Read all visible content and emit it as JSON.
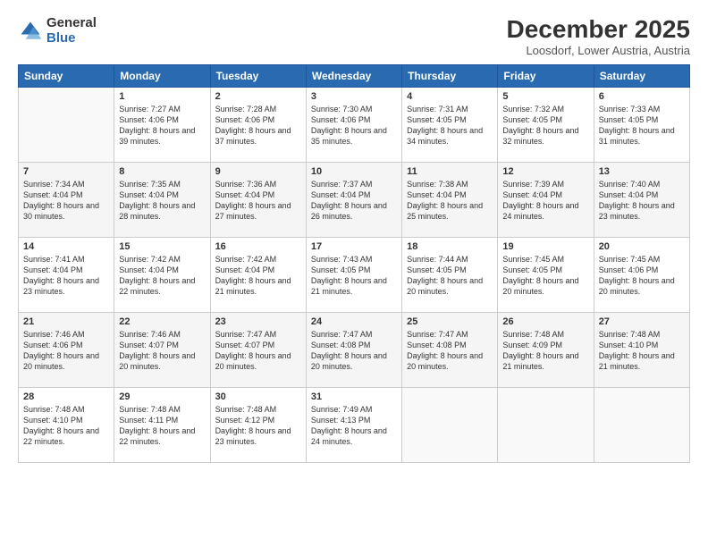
{
  "logo": {
    "general": "General",
    "blue": "Blue"
  },
  "title": "December 2025",
  "location": "Loosdorf, Lower Austria, Austria",
  "days_of_week": [
    "Sunday",
    "Monday",
    "Tuesday",
    "Wednesday",
    "Thursday",
    "Friday",
    "Saturday"
  ],
  "weeks": [
    [
      {
        "day": "",
        "sunrise": "",
        "sunset": "",
        "daylight": ""
      },
      {
        "day": "1",
        "sunrise": "Sunrise: 7:27 AM",
        "sunset": "Sunset: 4:06 PM",
        "daylight": "Daylight: 8 hours and 39 minutes."
      },
      {
        "day": "2",
        "sunrise": "Sunrise: 7:28 AM",
        "sunset": "Sunset: 4:06 PM",
        "daylight": "Daylight: 8 hours and 37 minutes."
      },
      {
        "day": "3",
        "sunrise": "Sunrise: 7:30 AM",
        "sunset": "Sunset: 4:06 PM",
        "daylight": "Daylight: 8 hours and 35 minutes."
      },
      {
        "day": "4",
        "sunrise": "Sunrise: 7:31 AM",
        "sunset": "Sunset: 4:05 PM",
        "daylight": "Daylight: 8 hours and 34 minutes."
      },
      {
        "day": "5",
        "sunrise": "Sunrise: 7:32 AM",
        "sunset": "Sunset: 4:05 PM",
        "daylight": "Daylight: 8 hours and 32 minutes."
      },
      {
        "day": "6",
        "sunrise": "Sunrise: 7:33 AM",
        "sunset": "Sunset: 4:05 PM",
        "daylight": "Daylight: 8 hours and 31 minutes."
      }
    ],
    [
      {
        "day": "7",
        "sunrise": "Sunrise: 7:34 AM",
        "sunset": "Sunset: 4:04 PM",
        "daylight": "Daylight: 8 hours and 30 minutes."
      },
      {
        "day": "8",
        "sunrise": "Sunrise: 7:35 AM",
        "sunset": "Sunset: 4:04 PM",
        "daylight": "Daylight: 8 hours and 28 minutes."
      },
      {
        "day": "9",
        "sunrise": "Sunrise: 7:36 AM",
        "sunset": "Sunset: 4:04 PM",
        "daylight": "Daylight: 8 hours and 27 minutes."
      },
      {
        "day": "10",
        "sunrise": "Sunrise: 7:37 AM",
        "sunset": "Sunset: 4:04 PM",
        "daylight": "Daylight: 8 hours and 26 minutes."
      },
      {
        "day": "11",
        "sunrise": "Sunrise: 7:38 AM",
        "sunset": "Sunset: 4:04 PM",
        "daylight": "Daylight: 8 hours and 25 minutes."
      },
      {
        "day": "12",
        "sunrise": "Sunrise: 7:39 AM",
        "sunset": "Sunset: 4:04 PM",
        "daylight": "Daylight: 8 hours and 24 minutes."
      },
      {
        "day": "13",
        "sunrise": "Sunrise: 7:40 AM",
        "sunset": "Sunset: 4:04 PM",
        "daylight": "Daylight: 8 hours and 23 minutes."
      }
    ],
    [
      {
        "day": "14",
        "sunrise": "Sunrise: 7:41 AM",
        "sunset": "Sunset: 4:04 PM",
        "daylight": "Daylight: 8 hours and 23 minutes."
      },
      {
        "day": "15",
        "sunrise": "Sunrise: 7:42 AM",
        "sunset": "Sunset: 4:04 PM",
        "daylight": "Daylight: 8 hours and 22 minutes."
      },
      {
        "day": "16",
        "sunrise": "Sunrise: 7:42 AM",
        "sunset": "Sunset: 4:04 PM",
        "daylight": "Daylight: 8 hours and 21 minutes."
      },
      {
        "day": "17",
        "sunrise": "Sunrise: 7:43 AM",
        "sunset": "Sunset: 4:05 PM",
        "daylight": "Daylight: 8 hours and 21 minutes."
      },
      {
        "day": "18",
        "sunrise": "Sunrise: 7:44 AM",
        "sunset": "Sunset: 4:05 PM",
        "daylight": "Daylight: 8 hours and 20 minutes."
      },
      {
        "day": "19",
        "sunrise": "Sunrise: 7:45 AM",
        "sunset": "Sunset: 4:05 PM",
        "daylight": "Daylight: 8 hours and 20 minutes."
      },
      {
        "day": "20",
        "sunrise": "Sunrise: 7:45 AM",
        "sunset": "Sunset: 4:06 PM",
        "daylight": "Daylight: 8 hours and 20 minutes."
      }
    ],
    [
      {
        "day": "21",
        "sunrise": "Sunrise: 7:46 AM",
        "sunset": "Sunset: 4:06 PM",
        "daylight": "Daylight: 8 hours and 20 minutes."
      },
      {
        "day": "22",
        "sunrise": "Sunrise: 7:46 AM",
        "sunset": "Sunset: 4:07 PM",
        "daylight": "Daylight: 8 hours and 20 minutes."
      },
      {
        "day": "23",
        "sunrise": "Sunrise: 7:47 AM",
        "sunset": "Sunset: 4:07 PM",
        "daylight": "Daylight: 8 hours and 20 minutes."
      },
      {
        "day": "24",
        "sunrise": "Sunrise: 7:47 AM",
        "sunset": "Sunset: 4:08 PM",
        "daylight": "Daylight: 8 hours and 20 minutes."
      },
      {
        "day": "25",
        "sunrise": "Sunrise: 7:47 AM",
        "sunset": "Sunset: 4:08 PM",
        "daylight": "Daylight: 8 hours and 20 minutes."
      },
      {
        "day": "26",
        "sunrise": "Sunrise: 7:48 AM",
        "sunset": "Sunset: 4:09 PM",
        "daylight": "Daylight: 8 hours and 21 minutes."
      },
      {
        "day": "27",
        "sunrise": "Sunrise: 7:48 AM",
        "sunset": "Sunset: 4:10 PM",
        "daylight": "Daylight: 8 hours and 21 minutes."
      }
    ],
    [
      {
        "day": "28",
        "sunrise": "Sunrise: 7:48 AM",
        "sunset": "Sunset: 4:10 PM",
        "daylight": "Daylight: 8 hours and 22 minutes."
      },
      {
        "day": "29",
        "sunrise": "Sunrise: 7:48 AM",
        "sunset": "Sunset: 4:11 PM",
        "daylight": "Daylight: 8 hours and 22 minutes."
      },
      {
        "day": "30",
        "sunrise": "Sunrise: 7:48 AM",
        "sunset": "Sunset: 4:12 PM",
        "daylight": "Daylight: 8 hours and 23 minutes."
      },
      {
        "day": "31",
        "sunrise": "Sunrise: 7:49 AM",
        "sunset": "Sunset: 4:13 PM",
        "daylight": "Daylight: 8 hours and 24 minutes."
      },
      {
        "day": "",
        "sunrise": "",
        "sunset": "",
        "daylight": ""
      },
      {
        "day": "",
        "sunrise": "",
        "sunset": "",
        "daylight": ""
      },
      {
        "day": "",
        "sunrise": "",
        "sunset": "",
        "daylight": ""
      }
    ]
  ]
}
